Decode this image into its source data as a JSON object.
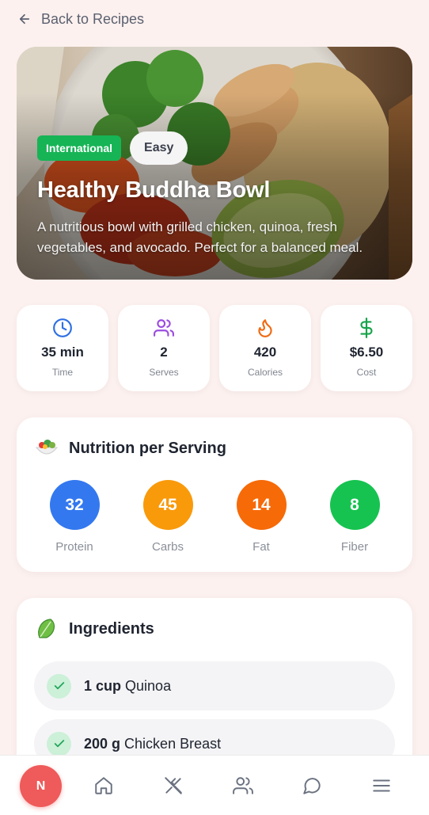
{
  "back": {
    "label": "Back to Recipes"
  },
  "hero": {
    "cuisine_badge": "International",
    "difficulty_badge": "Easy",
    "title": "Healthy Buddha Bowl",
    "description": "A nutritious bowl with grilled chicken, quinoa, fresh vegetables, and avocado. Perfect for a balanced meal."
  },
  "stats": [
    {
      "icon": "clock-icon",
      "value": "35 min",
      "label": "Time",
      "color": "#2f6fe4"
    },
    {
      "icon": "users-icon",
      "value": "2",
      "label": "Serves",
      "color": "#9b4de0"
    },
    {
      "icon": "flame-icon",
      "value": "420",
      "label": "Calories",
      "color": "#f06a12"
    },
    {
      "icon": "dollar-icon",
      "value": "$6.50",
      "label": "Cost",
      "color": "#17a34a"
    }
  ],
  "nutrition": {
    "title": "Nutrition per Serving",
    "items": [
      {
        "value": "32",
        "label": "Protein",
        "color": "#3378ef"
      },
      {
        "value": "45",
        "label": "Carbs",
        "color": "#f99a0b"
      },
      {
        "value": "14",
        "label": "Fat",
        "color": "#f66a08"
      },
      {
        "value": "8",
        "label": "Fiber",
        "color": "#16c350"
      }
    ]
  },
  "ingredients": {
    "title": "Ingredients",
    "items": [
      {
        "amount": "1 cup",
        "name": "Quinoa"
      },
      {
        "amount": "200 g",
        "name": "Chicken Breast"
      }
    ]
  },
  "bottom_nav": {
    "avatar_initial": "N",
    "items": [
      "home-icon",
      "utensils-icon",
      "users-icon",
      "chat-icon",
      "menu-icon"
    ]
  },
  "colors": {
    "accent": "#ef5a5a",
    "background": "#fdf1ef"
  }
}
